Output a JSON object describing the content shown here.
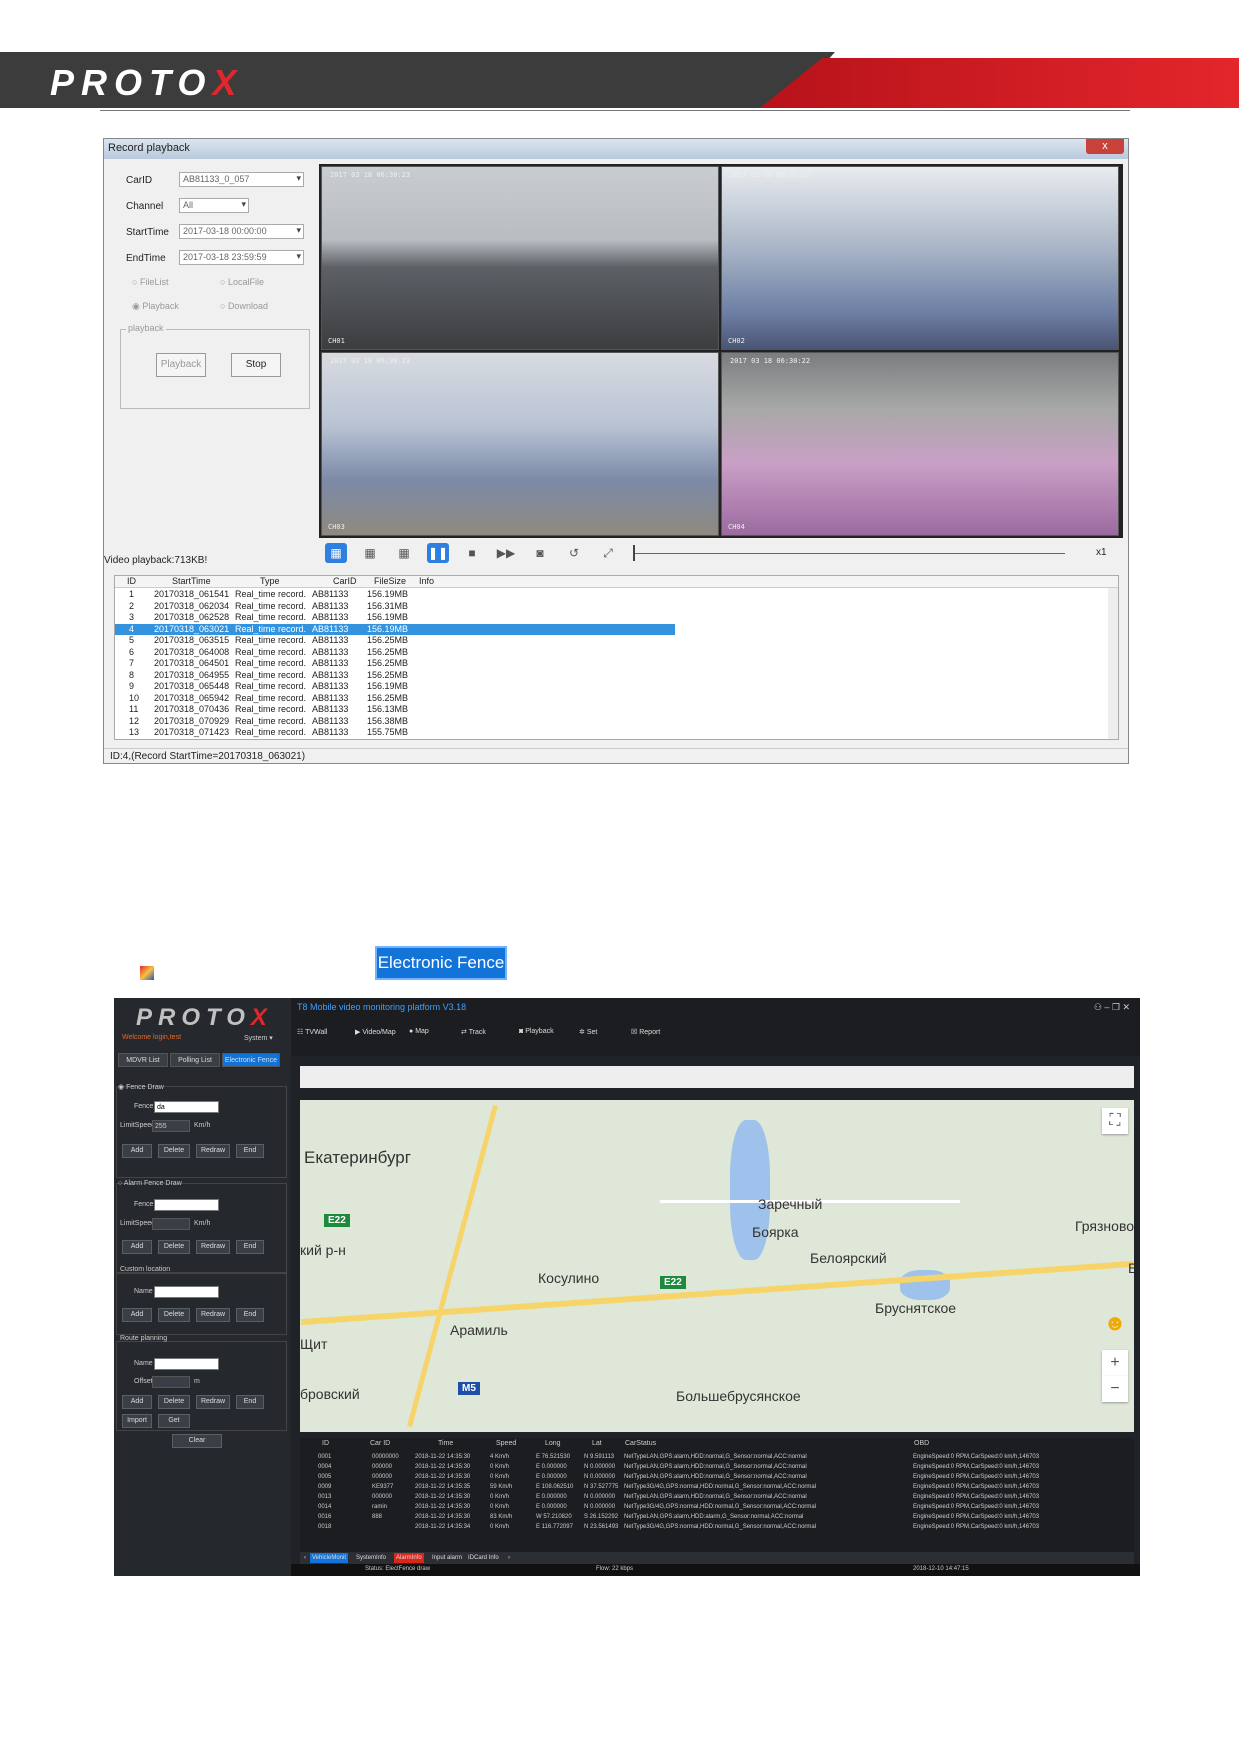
{
  "header": {
    "brand_left": "PROTO",
    "brand_x": "X"
  },
  "record_playback": {
    "title": "Record playback",
    "close_label": "x",
    "form": {
      "carid_label": "CarID",
      "carid_value": "AB81133_0_057",
      "channel_label": "Channel",
      "channel_value": "All",
      "start_label": "StartTime",
      "start_value": "2017-03-18 00:00:00",
      "end_label": "EndTime",
      "end_value": "2017-03-18 23:59:59",
      "radio_filelist": "FileList",
      "radio_localfile": "LocalFile",
      "radio_playback": "Playback",
      "radio_download": "Download",
      "group_label": "playback",
      "playback_btn": "Playback",
      "stop_btn": "Stop"
    },
    "video_status": "Video playback:713KB!",
    "speed": "x1",
    "videos": [
      {
        "osd_top": "2017 03 18 06:30:23",
        "osd_bottom": "CH01"
      },
      {
        "osd_top": "2017 03 18 06:30:22",
        "osd_bottom": "CH02"
      },
      {
        "osd_top": "2017 03 18 06:30:23",
        "osd_bottom": "CH03"
      },
      {
        "osd_top": "2017 03 18 06:30:22",
        "osd_bottom": "CH04"
      }
    ],
    "columns": [
      "ID",
      "StartTime",
      "Type",
      "CarID",
      "FileSize",
      "Info"
    ],
    "rows": [
      [
        "1",
        "20170318_061541",
        "Real_time record.",
        "AB81133",
        "156.19MB"
      ],
      [
        "2",
        "20170318_062034",
        "Real_time record.",
        "AB81133",
        "156.31MB"
      ],
      [
        "3",
        "20170318_062528",
        "Real_time record.",
        "AB81133",
        "156.19MB"
      ],
      [
        "4",
        "20170318_063021",
        "Real_time record.",
        "AB81133",
        "156.19MB"
      ],
      [
        "5",
        "20170318_063515",
        "Real_time record.",
        "AB81133",
        "156.25MB"
      ],
      [
        "6",
        "20170318_064008",
        "Real_time record.",
        "AB81133",
        "156.25MB"
      ],
      [
        "7",
        "20170318_064501",
        "Real_time record.",
        "AB81133",
        "156.25MB"
      ],
      [
        "8",
        "20170318_064955",
        "Real_time record.",
        "AB81133",
        "156.25MB"
      ],
      [
        "9",
        "20170318_065448",
        "Real_time record.",
        "AB81133",
        "156.19MB"
      ],
      [
        "10",
        "20170318_065942",
        "Real_time record.",
        "AB81133",
        "156.25MB"
      ],
      [
        "11",
        "20170318_070436",
        "Real_time record.",
        "AB81133",
        "156.13MB"
      ],
      [
        "12",
        "20170318_070929",
        "Real_time record.",
        "AB81133",
        "156.38MB"
      ],
      [
        "13",
        "20170318_071423",
        "Real_time record.",
        "AB81133",
        "155.75MB"
      ]
    ],
    "selected_row": 3,
    "status_line": "ID:4,(Record StartTime=20170318_063021)"
  },
  "electronic_fence_button": "Electronic Fence",
  "platform": {
    "title": "T8 Mobile video monitoring platform V3.18",
    "welcome": "Welcome login,test",
    "system_menu": "System",
    "tabs": [
      "MDVR List",
      "Polling List",
      "Electronic Fence"
    ],
    "menu": [
      "TVWall",
      "Video/Map",
      "Map",
      "Track",
      "Playback",
      "Set",
      "Report"
    ],
    "fence_draw": {
      "title": "Fence Draw",
      "fence_label": "Fence",
      "fence_value": "da",
      "limit_label": "LimitSpeed",
      "limit_value": "255",
      "unit": "Km/h"
    },
    "alarm_fence": {
      "title": "Alarm Fence Draw",
      "fence_label": "Fence",
      "limit_label": "LimitSpeed",
      "unit": "Km/h"
    },
    "custom_location": {
      "title": "Custom location",
      "name_label": "Name"
    },
    "route_planning": {
      "title": "Route planning",
      "name_label": "Name",
      "offset_label": "Offset",
      "offset_unit": "m"
    },
    "buttons": {
      "add": "Add",
      "delete": "Delete",
      "redraw": "Redraw",
      "end": "End",
      "import": "Import",
      "get": "Get",
      "clear": "Clear"
    },
    "map_labels": {
      "ekb": "Екатеринбург",
      "zarechny": "Заречный",
      "boyarka": "Боярка",
      "gryaznovo": "Грязново",
      "beloyarsky": "Белоярский",
      "kosulino": "Косулино",
      "brusnyatskoe": "Бруснятское",
      "aramil": "Арамиль",
      "kiy": "кий р-н",
      "shchit": "Щит",
      "borovskiy": "бровский",
      "bolshebrusyanskoe": "Большебрусянское",
      "e22a": "E22",
      "e22b": "E22",
      "m5": "M5",
      "e_edge": "Е"
    },
    "table_columns": [
      "ID",
      "Car ID",
      "Time",
      "Speed",
      "Long",
      "Lat",
      "CarStatus",
      "OBD"
    ],
    "table_rows": [
      [
        "0001",
        "00000000",
        "2018-11-22 14:35:30",
        "4 Km/h",
        "E 76.521530",
        "N 9.591113",
        "NetTypeLAN,GPS:alarm,HDD:normal,G_Sensor:normal,ACC:normal",
        "EngineSpeed:0 RPM,CarSpeed:0 km/h,146703"
      ],
      [
        "0004",
        "000000",
        "2018-11-22 14:35:30",
        "0 Km/h",
        "E 0.000000",
        "N 0.000000",
        "NetTypeLAN,GPS:alarm,HDD:normal,G_Sensor:normal,ACC:normal",
        "EngineSpeed:0 RPM,CarSpeed:0 km/h,146703"
      ],
      [
        "0005",
        "000000",
        "2018-11-22 14:35:30",
        "0 Km/h",
        "E 0.000000",
        "N 0.000000",
        "NetTypeLAN,GPS:alarm,HDD:normal,G_Sensor:normal,ACC:normal",
        "EngineSpeed:0 RPM,CarSpeed:0 km/h,146703"
      ],
      [
        "0009",
        "KE9377",
        "2018-11-22 14:35:35",
        "59 Km/h",
        "E 108.062510",
        "N 37.527775",
        "NetType3G/4G,GPS:normal,HDD:normal,G_Sensor:normal,ACC:normal",
        "EngineSpeed:0 RPM,CarSpeed:0 km/h,146703"
      ],
      [
        "0013",
        "000000",
        "2018-11-22 14:35:30",
        "0 Km/h",
        "E 0.000000",
        "N 0.000000",
        "NetTypeLAN,GPS:alarm,HDD:normal,G_Sensor:normal,ACC:normal",
        "EngineSpeed:0 RPM,CarSpeed:0 km/h,146703"
      ],
      [
        "0014",
        "ramin",
        "2018-11-22 14:35:30",
        "0 Km/h",
        "E 0.000000",
        "N 0.000000",
        "NetType3G/4G,GPS:normal,HDD:normal,G_Sensor:normal,ACC:normal",
        "EngineSpeed:0 RPM,CarSpeed:0 km/h,146703"
      ],
      [
        "0016",
        "888",
        "2018-11-22 14:35:30",
        "83 Km/h",
        "W 57.210820",
        "S 26.152292",
        "NetTypeLAN,GPS:alarm,HDD:alarm,G_Sensor:normal,ACC:normal",
        "EngineSpeed:0 RPM,CarSpeed:0 km/h,146703"
      ],
      [
        "0018",
        "",
        "2018-11-22 14:35:34",
        "0 Km/h",
        "E 116.772097",
        "N 23.561493",
        "NetType3G/4G,GPS:normal,HDD:normal,G_Sensor:normal,ACC:normal",
        "EngineSpeed:0 RPM,CarSpeed:0 km/h,146703"
      ]
    ],
    "bottom_tabs": [
      "VehicleMonit",
      "SystemInfo",
      "AlarmInfo",
      "Input alarm",
      "IDCard Info"
    ],
    "status": {
      "text": "Status: ElectFence draw",
      "flow": "Flow: 22 kbps",
      "time": "2018-12-10 14:47:15"
    }
  }
}
